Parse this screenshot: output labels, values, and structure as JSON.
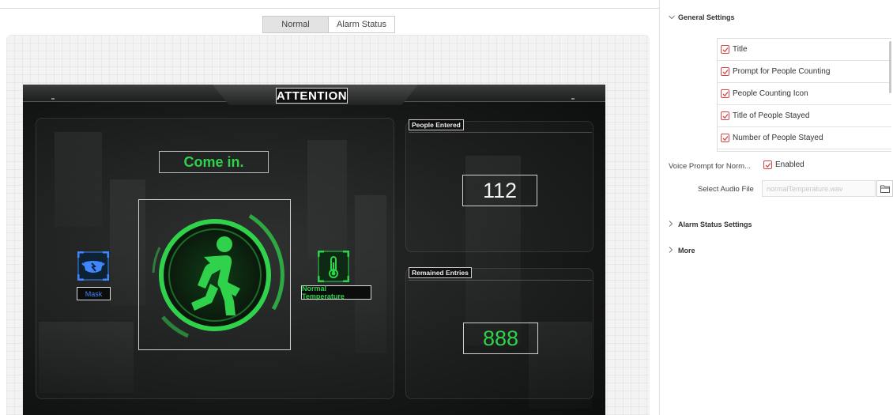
{
  "mode_tabs": {
    "normal": "Normal",
    "alarm_status": "Alarm Status",
    "active": "Normal"
  },
  "preview": {
    "header_title": "ATTENTION",
    "prompt_text": "Come in.",
    "mask_label": "Mask",
    "temperature_label": "Normal Temperature",
    "people_entered": {
      "label": "People Entered",
      "value": "112"
    },
    "remained_entries": {
      "label": "Remained Entries",
      "value": "888"
    },
    "icons": {
      "main": "walking-person-icon",
      "mask": "mask-icon",
      "temperature": "thermometer-icon"
    },
    "colors": {
      "accent_green": "#2fd24a",
      "mask_blue": "#3f86ff",
      "entries_white": "#f2f2f2"
    }
  },
  "settings": {
    "general": {
      "title": "General Settings",
      "items": [
        {
          "label": "Title",
          "checked": true
        },
        {
          "label": "Prompt for People Counting",
          "checked": true
        },
        {
          "label": "People Counting Icon",
          "checked": true
        },
        {
          "label": "Title of People Stayed",
          "checked": true
        },
        {
          "label": "Number of People Stayed",
          "checked": true
        }
      ],
      "voice_prompt": {
        "label": "Voice Prompt for Norm...",
        "checkbox_label": "Enabled",
        "checked": true
      },
      "audio_file": {
        "label": "Select Audio File",
        "placeholder": "normalTemperature.wav"
      }
    },
    "alarm_status_settings": {
      "title": "Alarm Status Settings"
    },
    "more": {
      "title": "More"
    }
  }
}
